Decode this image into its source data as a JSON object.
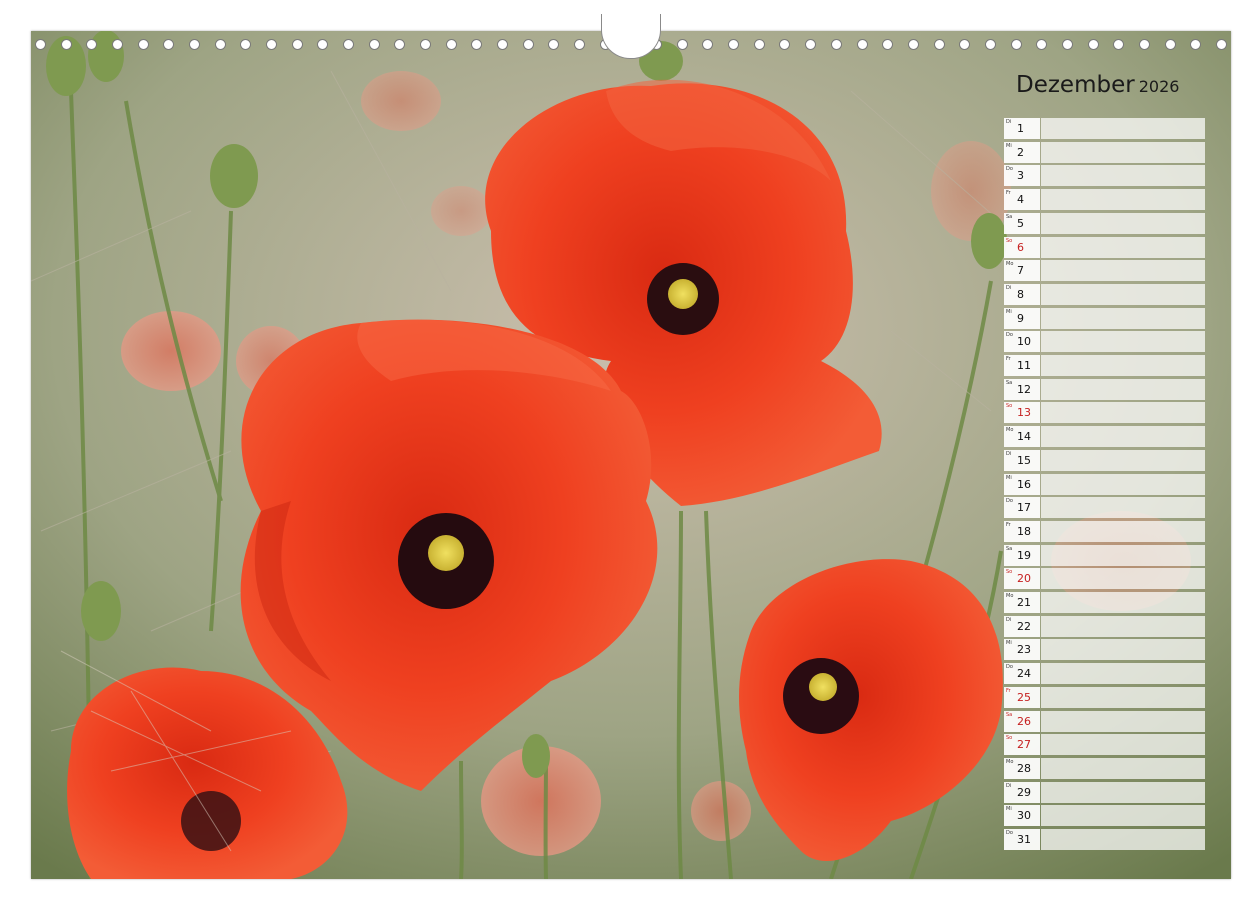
{
  "calendar": {
    "month": "Dezember",
    "year": "2026",
    "days": [
      {
        "abbr": "Di",
        "num": "1",
        "weekend": false
      },
      {
        "abbr": "Mi",
        "num": "2",
        "weekend": false
      },
      {
        "abbr": "Do",
        "num": "3",
        "weekend": false
      },
      {
        "abbr": "Fr",
        "num": "4",
        "weekend": false
      },
      {
        "abbr": "Sa",
        "num": "5",
        "weekend": false
      },
      {
        "abbr": "So",
        "num": "6",
        "weekend": true
      },
      {
        "abbr": "Mo",
        "num": "7",
        "weekend": false
      },
      {
        "abbr": "Di",
        "num": "8",
        "weekend": false
      },
      {
        "abbr": "Mi",
        "num": "9",
        "weekend": false
      },
      {
        "abbr": "Do",
        "num": "10",
        "weekend": false
      },
      {
        "abbr": "Fr",
        "num": "11",
        "weekend": false
      },
      {
        "abbr": "Sa",
        "num": "12",
        "weekend": false
      },
      {
        "abbr": "So",
        "num": "13",
        "weekend": true
      },
      {
        "abbr": "Mo",
        "num": "14",
        "weekend": false
      },
      {
        "abbr": "Di",
        "num": "15",
        "weekend": false
      },
      {
        "abbr": "Mi",
        "num": "16",
        "weekend": false
      },
      {
        "abbr": "Do",
        "num": "17",
        "weekend": false
      },
      {
        "abbr": "Fr",
        "num": "18",
        "weekend": false
      },
      {
        "abbr": "Sa",
        "num": "19",
        "weekend": false
      },
      {
        "abbr": "So",
        "num": "20",
        "weekend": true
      },
      {
        "abbr": "Mo",
        "num": "21",
        "weekend": false
      },
      {
        "abbr": "Di",
        "num": "22",
        "weekend": false
      },
      {
        "abbr": "Mi",
        "num": "23",
        "weekend": false
      },
      {
        "abbr": "Do",
        "num": "24",
        "weekend": false
      },
      {
        "abbr": "Fr",
        "num": "25",
        "weekend": true
      },
      {
        "abbr": "Sa",
        "num": "26",
        "weekend": true
      },
      {
        "abbr": "So",
        "num": "27",
        "weekend": true
      },
      {
        "abbr": "Mo",
        "num": "28",
        "weekend": false
      },
      {
        "abbr": "Di",
        "num": "29",
        "weekend": false
      },
      {
        "abbr": "Mi",
        "num": "30",
        "weekend": false
      },
      {
        "abbr": "Do",
        "num": "31",
        "weekend": false
      }
    ]
  },
  "colors": {
    "poppy_red": "#ec3a1c",
    "holiday_red": "#c62020"
  }
}
